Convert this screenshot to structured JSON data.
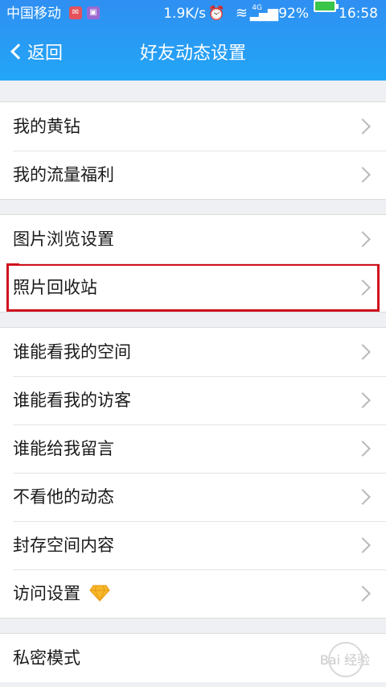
{
  "status_bar": {
    "carrier": "中国移动",
    "speed": "1.9K/s",
    "network": "4G",
    "battery": "92%",
    "time": "16:58"
  },
  "nav": {
    "back_label": "返回",
    "title": "好友动态设置"
  },
  "groups": [
    {
      "items": [
        {
          "label": "我的黄钻"
        },
        {
          "label": "我的流量福利"
        }
      ]
    },
    {
      "items": [
        {
          "label": "图片浏览设置"
        },
        {
          "label": "照片回收站"
        }
      ]
    },
    {
      "items": [
        {
          "label": "谁能看我的空间"
        },
        {
          "label": "谁能看我的访客"
        },
        {
          "label": "谁能给我留言"
        },
        {
          "label": "不看他的动态"
        },
        {
          "label": "封存空间内容"
        },
        {
          "label": "访问设置"
        }
      ]
    },
    {
      "items": [
        {
          "label": "私密模式"
        }
      ]
    }
  ],
  "watermark": "Bai 经验",
  "colors": {
    "header": "#2a9af4",
    "highlight": "#d0121e"
  }
}
